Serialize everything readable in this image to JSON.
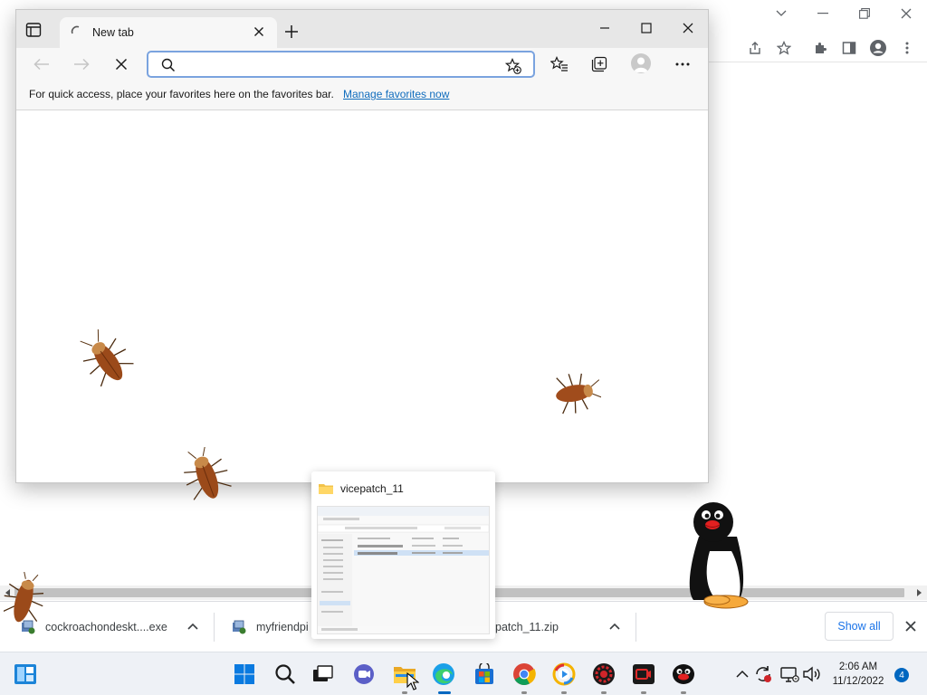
{
  "edge": {
    "tab_title": "New tab",
    "address_value": "",
    "address_placeholder": "",
    "favorites_bar_text": "For quick access, place your favorites here on the favorites bar.",
    "favorites_bar_link": "Manage favorites now"
  },
  "downloads": {
    "items": [
      {
        "name": "cockroachondeskt....exe",
        "icon": "installer-icon"
      },
      {
        "name": "myfriendpi",
        "icon": "installer-icon"
      },
      {
        "name": "patch_11.zip",
        "icon": "zip-icon"
      }
    ],
    "show_all_label": "Show all"
  },
  "thumbnail": {
    "title": "vicepatch_11"
  },
  "taskbar": {
    "time": "2:06 AM",
    "date": "11/12/2022",
    "notification_count": "4",
    "pinned": [
      "widgets",
      "start",
      "search",
      "task-view",
      "teams-chat",
      "file-explorer",
      "edge",
      "microsoft-store",
      "chrome",
      "app-ring",
      "app-red-gear",
      "app-red-camera",
      "app-penguin"
    ]
  },
  "colors": {
    "edge_accent": "#0f6cbd",
    "chrome_link": "#1a73e8",
    "taskbar_bg": "#eef1f6",
    "badge": "#0067c0"
  }
}
